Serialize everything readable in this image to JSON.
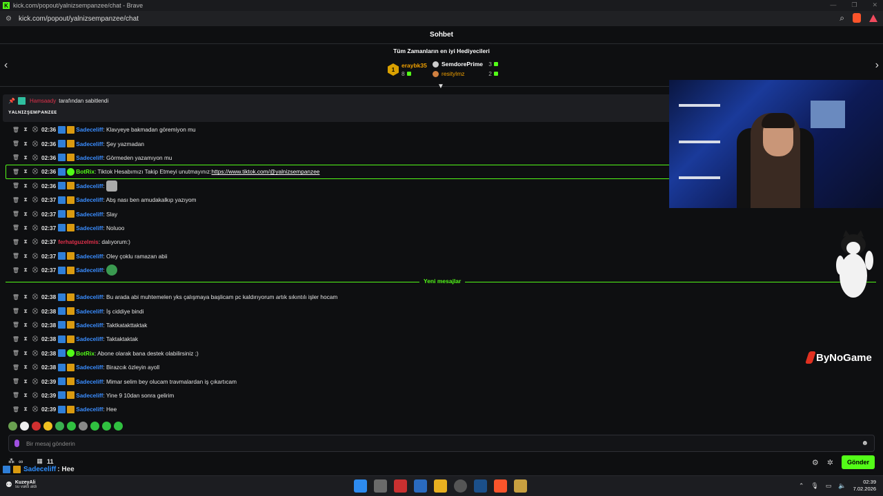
{
  "browser": {
    "window_title": "kick.com/popout/yalnizsempanzee/chat - Brave",
    "url": "kick.com/popout/yalnizsempanzee/chat",
    "minimize": "—",
    "maximize": "❐",
    "close": "✕"
  },
  "chat": {
    "title": "Sohbet",
    "gifters_title": "Tüm Zamanların en iyi Hediyecileri",
    "gifters": [
      {
        "rank": "1",
        "name": "eraybk35",
        "count": "8",
        "medal_color": "#d9a000"
      },
      {
        "name": "SemdorePrime",
        "count": "3",
        "medal_color": "#cccccc"
      },
      {
        "name": "resitylmz",
        "count": "2",
        "medal_color": "#d08040"
      }
    ],
    "pinned": {
      "pinned_by": "Hamsaady",
      "suffix": "tarafından sabitlendi",
      "text": "ʏᴀʟɴɪᴢşᴇᴍᴘᴀɴᴢᴇᴇ"
    },
    "messages": [
      {
        "time": "02:36",
        "user": "Sadeceliff",
        "user_color": "#3a8dff",
        "text": ": Klavyeye bakmadan göremiyon mu"
      },
      {
        "time": "02:36",
        "user": "Sadeceliff",
        "user_color": "#3a8dff",
        "text": ": Şey yazmadan"
      },
      {
        "time": "02:36",
        "user": "Sadeceliff",
        "user_color": "#3a8dff",
        "text": ": Görmeden yazamıyon mu"
      },
      {
        "time": "02:36",
        "user": "BotRix",
        "user_color": "#53fc18",
        "text": ": Tiktok Hesabımızı Takip Etmeyi unutmayınız: ",
        "link": "https://www.tiktok.com/@yalnizsempanzee",
        "highlight": true
      },
      {
        "time": "02:36",
        "user": "Sadeceliff",
        "user_color": "#3a8dff",
        "text": ":",
        "emote": "cat-emote"
      },
      {
        "time": "02:37",
        "user": "Sadeceliff",
        "user_color": "#3a8dff",
        "text": ": Abş nası ben amudakalkıp yazıyom"
      },
      {
        "time": "02:37",
        "user": "Sadeceliff",
        "user_color": "#3a8dff",
        "text": ": Slay"
      },
      {
        "time": "02:37",
        "user": "Sadeceliff",
        "user_color": "#3a8dff",
        "text": ": Noluoo"
      },
      {
        "time": "02:37",
        "user": "ferhatguzelmis",
        "user_color": "#e0304a",
        "text": ": dalıyorum:)",
        "no_badges": true
      },
      {
        "time": "02:37",
        "user": "Sadeceliff",
        "user_color": "#3a8dff",
        "text": ": Oley çoklu ramazan abii"
      },
      {
        "time": "02:37",
        "user": "Sadeceliff",
        "user_color": "#3a8dff",
        "text": ":",
        "emote": "pepe-emote"
      }
    ],
    "new_messages_label": "Yeni mesajlar",
    "messages_new": [
      {
        "time": "02:38",
        "user": "Sadeceliff",
        "user_color": "#3a8dff",
        "text": ": Bu arada abi muhtemelen yks çalışmaya başlicam pc kaldırıyorum artık sıkıntılı işler hocam"
      },
      {
        "time": "02:38",
        "user": "Sadeceliff",
        "user_color": "#3a8dff",
        "text": ": İş ciddiye bindi"
      },
      {
        "time": "02:38",
        "user": "Sadeceliff",
        "user_color": "#3a8dff",
        "text": ": Taktkatakttaktak"
      },
      {
        "time": "02:38",
        "user": "Sadeceliff",
        "user_color": "#3a8dff",
        "text": ": Taktaktaktak"
      },
      {
        "time": "02:38",
        "user": "BotRix",
        "user_color": "#53fc18",
        "text": ": Abone olarak bana destek olabilirsiniz ;)"
      },
      {
        "time": "02:38",
        "user": "Sadeceliff",
        "user_color": "#3a8dff",
        "text": ": Birazcık özleyin ayoll"
      },
      {
        "time": "02:39",
        "user": "Sadeceliff",
        "user_color": "#3a8dff",
        "text": ": Mimar selim bey olucam travmalardan iş çıkartıcam"
      },
      {
        "time": "02:39",
        "user": "Sadeceliff",
        "user_color": "#3a8dff",
        "text": ": Yine 9 10dan sonra gelirim"
      },
      {
        "time": "02:39",
        "user": "Sadeceliff",
        "user_color": "#3a8dff",
        "text": ": Hee"
      }
    ],
    "input_placeholder": "Bir mesaj gönderin",
    "send_label": "Gönder",
    "infinity": "∞",
    "viewer_count": "11"
  },
  "overlay": {
    "brand": "ByNoGame",
    "last_user": "Sadeceliff",
    "last_text": ": Hee"
  },
  "taskbar": {
    "user_name": "KuzeyAli",
    "user_status": "su vakti aldı",
    "time": "02:39",
    "date": "7.02.2026"
  },
  "colors": {
    "accent": "#53fc18",
    "bg": "#0e0f11"
  }
}
